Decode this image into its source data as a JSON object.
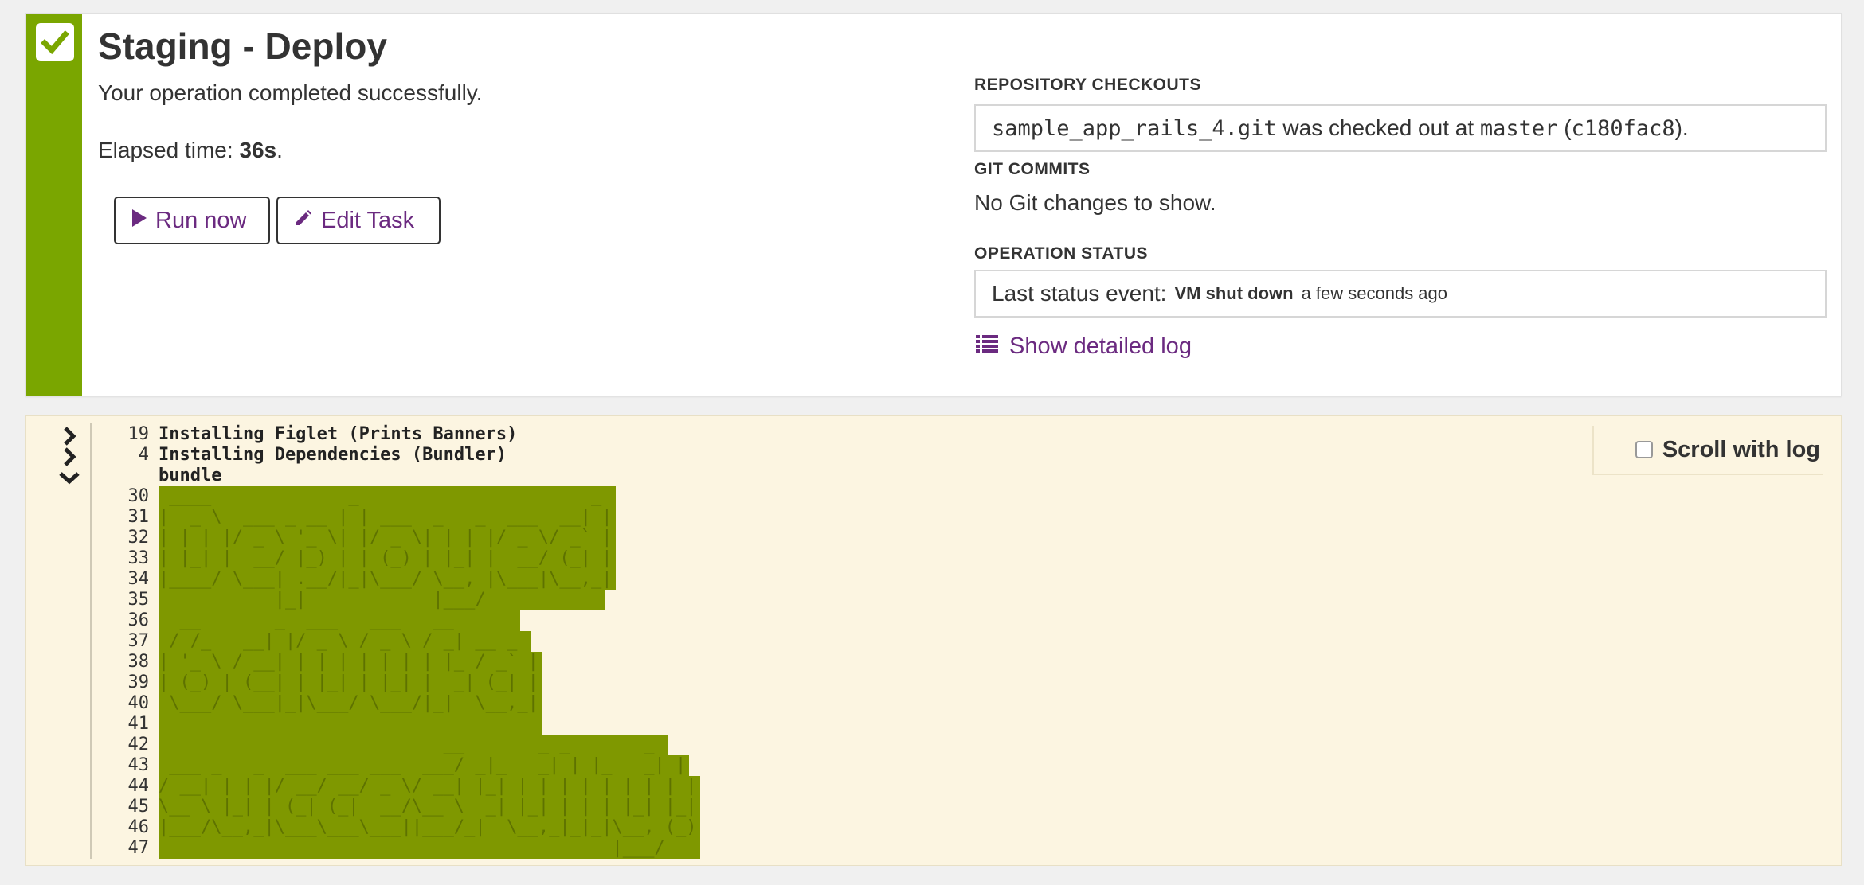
{
  "header": {
    "title": "Staging - Deploy",
    "subtitle": "Your operation completed successfully.",
    "elapsed_label": "Elapsed time: ",
    "elapsed_value": "36s",
    "elapsed_suffix": "."
  },
  "actions": {
    "run_label": "Run now",
    "edit_label": "Edit Task"
  },
  "repository_checkouts": {
    "heading": "REPOSITORY CHECKOUTS",
    "repo": "sample_app_rails_4.git",
    "mid_text": " was checked out at ",
    "branch": "master",
    "open_paren": " (",
    "commit": "c180fac8",
    "close_paren": ")."
  },
  "git_commits": {
    "heading": "GIT COMMITS",
    "text": "No Git changes to show."
  },
  "operation_status": {
    "heading": "OPERATION STATUS",
    "label": "Last status event:",
    "event": "VM shut down",
    "when": "a few seconds ago",
    "log_link": "Show detailed log"
  },
  "log": {
    "scroll_label": "Scroll with log",
    "scroll_checked": false,
    "groups": [
      {
        "count": "19",
        "title": "Installing Figlet (Prints Banners)",
        "state": "collapsed"
      },
      {
        "count": "4",
        "title": "Installing Dependencies (Bundler)",
        "state": "collapsed"
      },
      {
        "count": "",
        "title": "bundle",
        "state": "expanded"
      }
    ],
    "lines": [
      {
        "n": "30",
        "t": " ____             _                      _ "
      },
      {
        "n": "31",
        "t": "|  _ \\  ___ _ __ | | ___  _   _  ___  __| |"
      },
      {
        "n": "32",
        "t": "| | | |/ _ \\ '_ \\| |/ _ \\| | | |/ _ \\/ _` |"
      },
      {
        "n": "33",
        "t": "| |_| |  __/ |_) | | (_) | |_| |  __/ (_| |"
      },
      {
        "n": "34",
        "t": "|____/ \\___| .__/|_|\\___/ \\__, |\\___|\\__,_|"
      },
      {
        "n": "35",
        "t": "           |_|            |___/           "
      },
      {
        "n": "36",
        "t": "  __       _  ___   ___   __      "
      },
      {
        "n": "37",
        "t": " / /_   __| |/ _ \\ / _ \\ / _| __ _ "
      },
      {
        "n": "38",
        "t": "| '_ \\ / __| | | | | | | | |_ / _` |"
      },
      {
        "n": "39",
        "t": "| (_) | (__| | |_| | |_| |  _| (_| |"
      },
      {
        "n": "40",
        "t": " \\___/ \\___|_|\\___/ \\___/|_|  \\__,_|"
      },
      {
        "n": "41",
        "t": "                                    "
      },
      {
        "n": "42",
        "t": "                           __       _ _       _ "
      },
      {
        "n": "43",
        "t": " ___ _   _  ___ ___ ___  ___/ _|_   _| | |_   _| |"
      },
      {
        "n": "44",
        "t": "/ __| | | |/ __/ __/ _ \\/ __| |_| | | | | | | | | |"
      },
      {
        "n": "45",
        "t": "\\__ \\ |_| | (_| (_|  __/\\__ \\  _| |_| | | | |_| |_|"
      },
      {
        "n": "46",
        "t": "|___/\\__,_|\\___\\___\\___||___/_|  \\__,_|_|_|\\__, (_)"
      },
      {
        "n": "47",
        "t": "                                           |___/   "
      }
    ]
  },
  "colors": {
    "success": "#7aa600",
    "link": "#6b2a80",
    "log_bg": "#fcf5e1",
    "banner_bg": "#7f9800"
  },
  "icons": {
    "status": "check-icon",
    "run": "play-icon",
    "edit": "pencil-icon",
    "log_link": "list-icon",
    "group_collapsed": "chevron-right-icon",
    "group_expanded": "chevron-down-icon"
  }
}
